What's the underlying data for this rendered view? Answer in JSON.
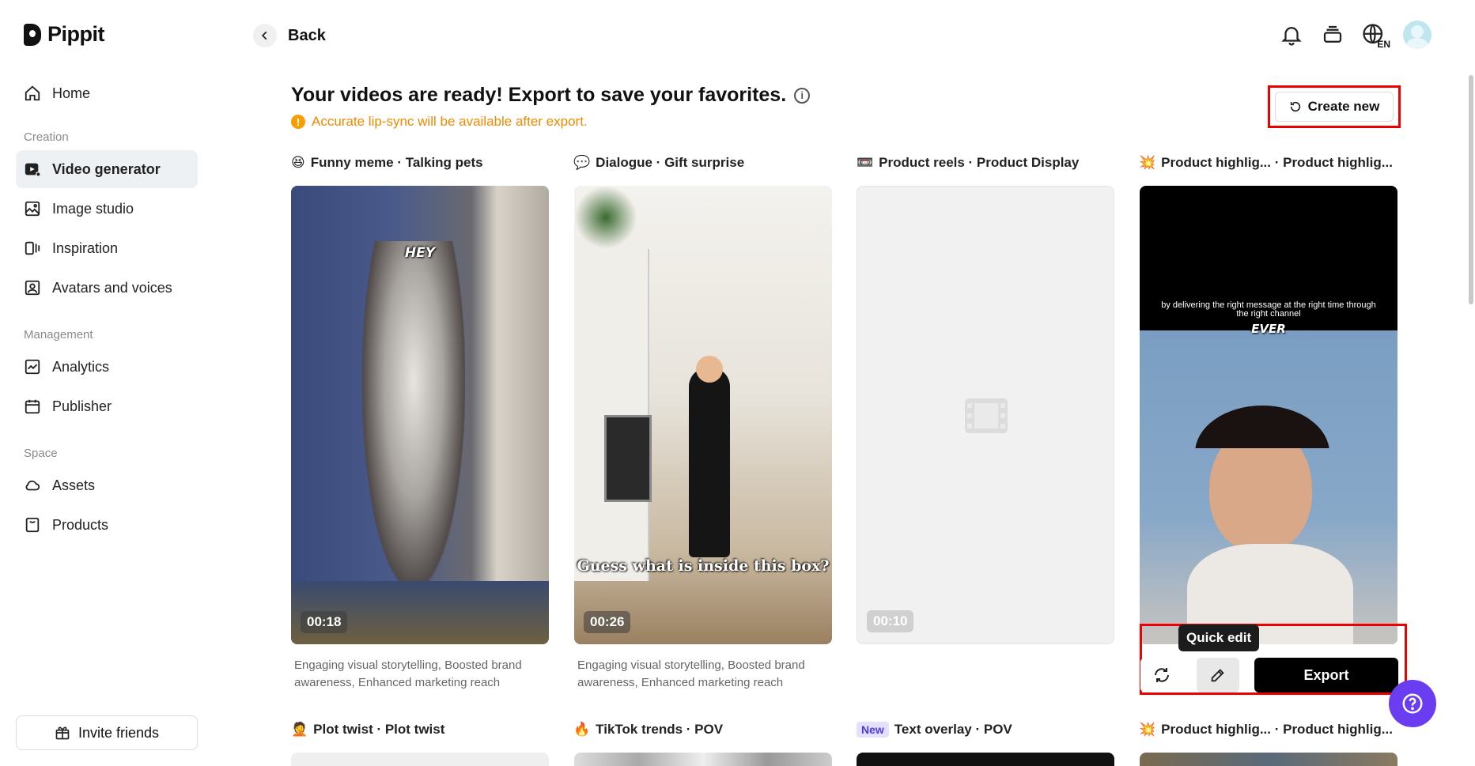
{
  "app": {
    "logo_text": "Pippit"
  },
  "sidebar": {
    "home": "Home",
    "sections": {
      "creation": "Creation",
      "management": "Management",
      "space": "Space"
    },
    "items": {
      "video_generator": "Video generator",
      "image_studio": "Image studio",
      "inspiration": "Inspiration",
      "avatars_voices": "Avatars and voices",
      "analytics": "Analytics",
      "publisher": "Publisher",
      "assets": "Assets",
      "products": "Products"
    },
    "invite": "Invite friends"
  },
  "header": {
    "back_label": "Back",
    "lang": "EN"
  },
  "main": {
    "title": "Your videos are ready! Export to save your favorites.",
    "notice": "Accurate lip-sync will be available after export.",
    "create_new": "Create new"
  },
  "cards": [
    {
      "emoji": "😆",
      "title": "Funny meme · Talking pets",
      "duration": "00:18",
      "desc": "Engaging visual storytelling, Boosted brand awareness, Enhanced marketing reach",
      "caption": "HEY"
    },
    {
      "emoji": "💬",
      "title": "Dialogue · Gift surprise",
      "duration": "00:26",
      "desc": "Engaging visual storytelling, Boosted brand awareness, Enhanced marketing reach",
      "caption": "Guess what is inside this box?"
    },
    {
      "emoji": "📼",
      "title": "Product reels · Product Display",
      "duration": "00:10"
    },
    {
      "emoji": "💥",
      "title": "Product highlig... · Product highlig...",
      "caption_top": "by delivering the right message at the right time through the right channel",
      "caption_word": "EVER"
    }
  ],
  "row2": [
    {
      "emoji": "🤦",
      "title": "Plot twist · Plot twist"
    },
    {
      "emoji": "🔥",
      "title": "TikTok trends · POV"
    },
    {
      "badge": "New",
      "title": "Text overlay · POV"
    },
    {
      "emoji": "💥",
      "title": "Product highlig... · Product highlig..."
    }
  ],
  "actions": {
    "tooltip": "Quick edit",
    "export": "Export"
  }
}
